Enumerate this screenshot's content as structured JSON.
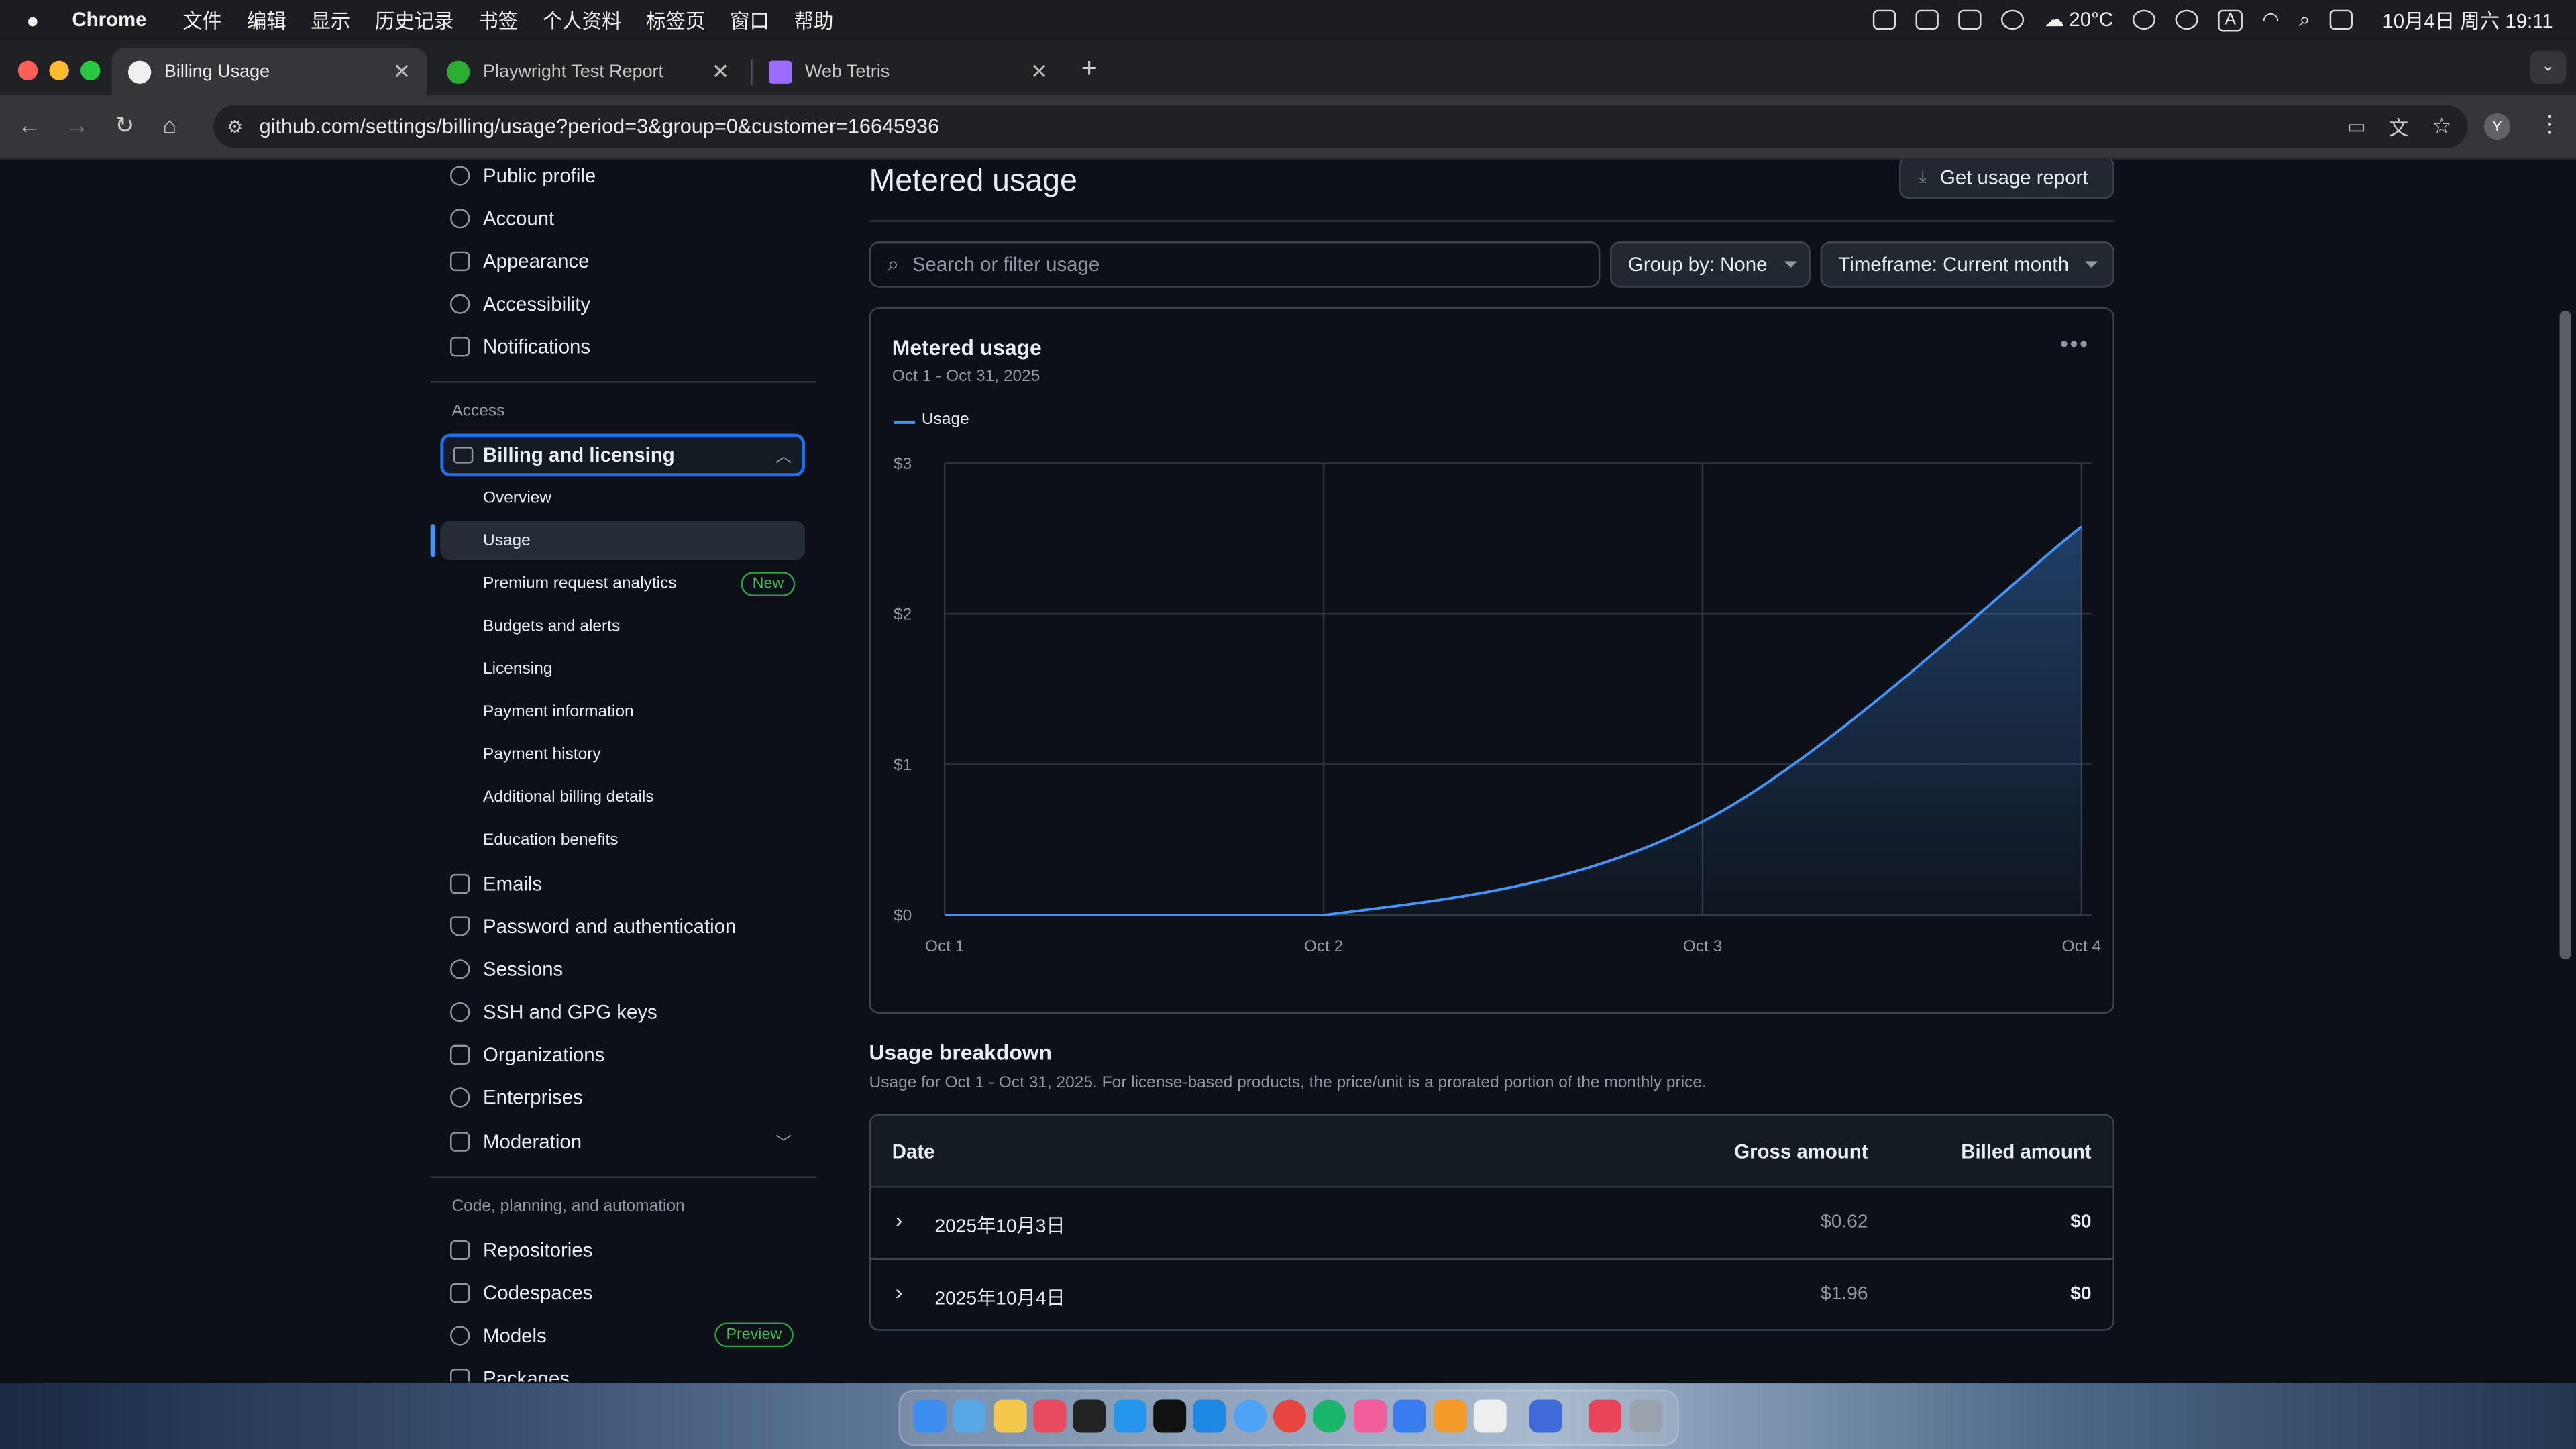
{
  "menubar": {
    "app": "Chrome",
    "items": [
      "文件",
      "编辑",
      "显示",
      "历史记录",
      "书签",
      "个人资料",
      "标签页",
      "窗口",
      "帮助"
    ],
    "weather": "20°C",
    "input_method": "A",
    "datetime": "10月4日 周六  19:11"
  },
  "tabs": [
    {
      "title": "Billing Usage",
      "active": true
    },
    {
      "title": "Playwright Test Report",
      "active": false
    },
    {
      "title": "Web Tetris",
      "active": false
    }
  ],
  "address_bar": {
    "url": "github.com/settings/billing/usage?period=3&group=0&customer=16645936"
  },
  "profile_initial": "Y",
  "sidebar": {
    "top_items": [
      "Public profile",
      "Account",
      "Appearance",
      "Accessibility",
      "Notifications"
    ],
    "access_label": "Access",
    "billing": {
      "label": "Billing and licensing",
      "subitems": [
        "Overview",
        "Usage",
        "Premium request analytics",
        "Budgets and alerts",
        "Licensing",
        "Payment information",
        "Payment history",
        "Additional billing details",
        "Education benefits"
      ],
      "selected": "Usage",
      "new_badge": "New"
    },
    "more_items": [
      "Emails",
      "Password and authentication",
      "Sessions",
      "SSH and GPG keys",
      "Organizations",
      "Enterprises",
      "Moderation"
    ],
    "code_section_label": "Code, planning, and automation",
    "code_items": [
      "Repositories",
      "Codespaces",
      "Models",
      "Packages"
    ],
    "preview_badge": "Preview"
  },
  "main": {
    "heading": "Metered usage",
    "report_button": "Get usage report",
    "search_placeholder": "Search or filter usage",
    "group_by": "Group by: None",
    "timeframe": "Timeframe: Current month"
  },
  "chart_card": {
    "title": "Metered usage",
    "date_range": "Oct 1 - Oct 31, 2025",
    "legend": "Usage"
  },
  "chart_data": {
    "type": "area",
    "title": "Metered usage",
    "x": [
      "Oct 1",
      "Oct 2",
      "Oct 3",
      "Oct 4"
    ],
    "series": [
      {
        "name": "Usage",
        "values": [
          0,
          0,
          0.62,
          2.58
        ]
      }
    ],
    "y_ticks": [
      "$0",
      "$1",
      "$2",
      "$3"
    ],
    "ylim": [
      0,
      3
    ],
    "grid": true,
    "legend_position": "top-left",
    "color": "#4493f8"
  },
  "breakdown": {
    "heading": "Usage breakdown",
    "description": "Usage for Oct 1 - Oct 31, 2025. For license-based products, the price/unit is a prorated portion of the monthly price.",
    "columns": [
      "Date",
      "Gross amount",
      "Billed amount"
    ],
    "rows": [
      {
        "date": "2025年10月3日",
        "gross": "$0.62",
        "billed": "$0"
      },
      {
        "date": "2025年10月4日",
        "gross": "$1.96",
        "billed": "$0"
      }
    ]
  }
}
